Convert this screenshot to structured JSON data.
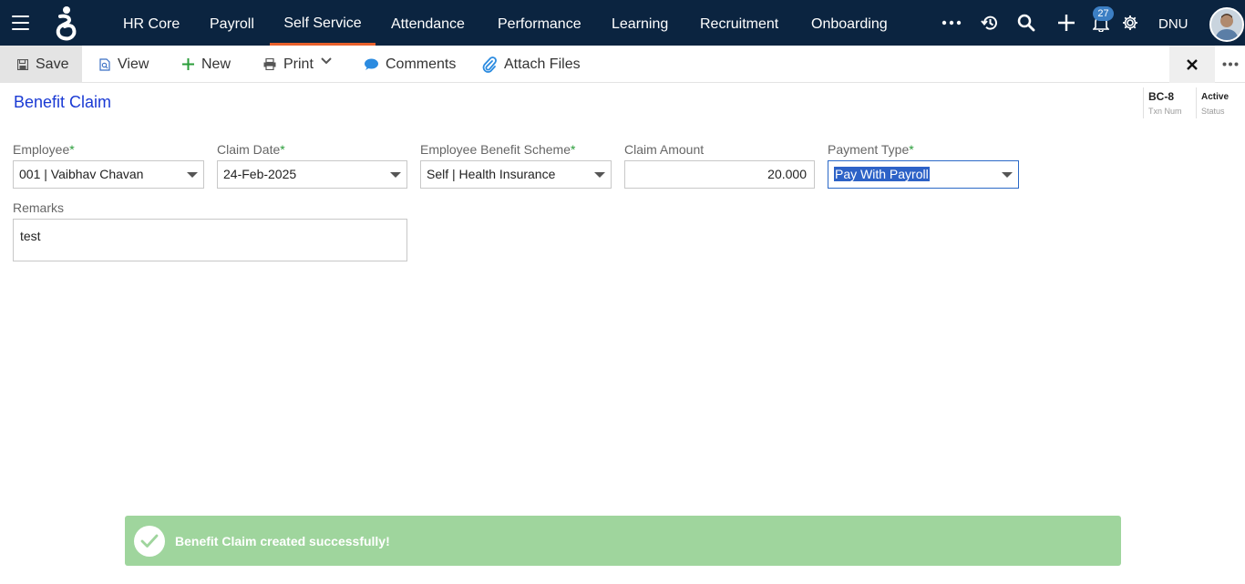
{
  "nav": {
    "items": [
      {
        "label": "HR Core"
      },
      {
        "label": "Payroll"
      },
      {
        "label": "Self Service",
        "active": true
      },
      {
        "label": "Attendance"
      },
      {
        "label": "Performance"
      },
      {
        "label": "Learning"
      },
      {
        "label": "Recruitment"
      },
      {
        "label": "Onboarding"
      }
    ],
    "notification_count": "27",
    "user_code": "DNU"
  },
  "toolbar": {
    "save_label": "Save",
    "view_label": "View",
    "new_label": "New",
    "print_label": "Print",
    "comments_label": "Comments",
    "attach_label": "Attach Files"
  },
  "header": {
    "title": "Benefit Claim",
    "txn_num_value": "BC-8",
    "txn_num_label": "Txn Num",
    "status_value": "Active",
    "status_label": "Status"
  },
  "form": {
    "employee": {
      "label": "Employee",
      "value": "001 | Vaibhav Chavan"
    },
    "claim_date": {
      "label": "Claim Date",
      "value": "24-Feb-2025"
    },
    "scheme": {
      "label": "Employee Benefit Scheme",
      "value": "Self | Health Insurance"
    },
    "claim_amount": {
      "label": "Claim Amount",
      "value": "20.000"
    },
    "payment_type": {
      "label": "Payment Type",
      "value": "Pay With Payroll"
    },
    "remarks": {
      "label": "Remarks",
      "value": "test"
    },
    "required_marker": "*"
  },
  "toast": {
    "message": "Benefit Claim created successfully!"
  },
  "colors": {
    "topbar": "#0b2440",
    "active_tab_underline": "#e8602c",
    "title": "#1a3ad4",
    "toast": "#9fd59d",
    "required": "#2a9d3a"
  }
}
